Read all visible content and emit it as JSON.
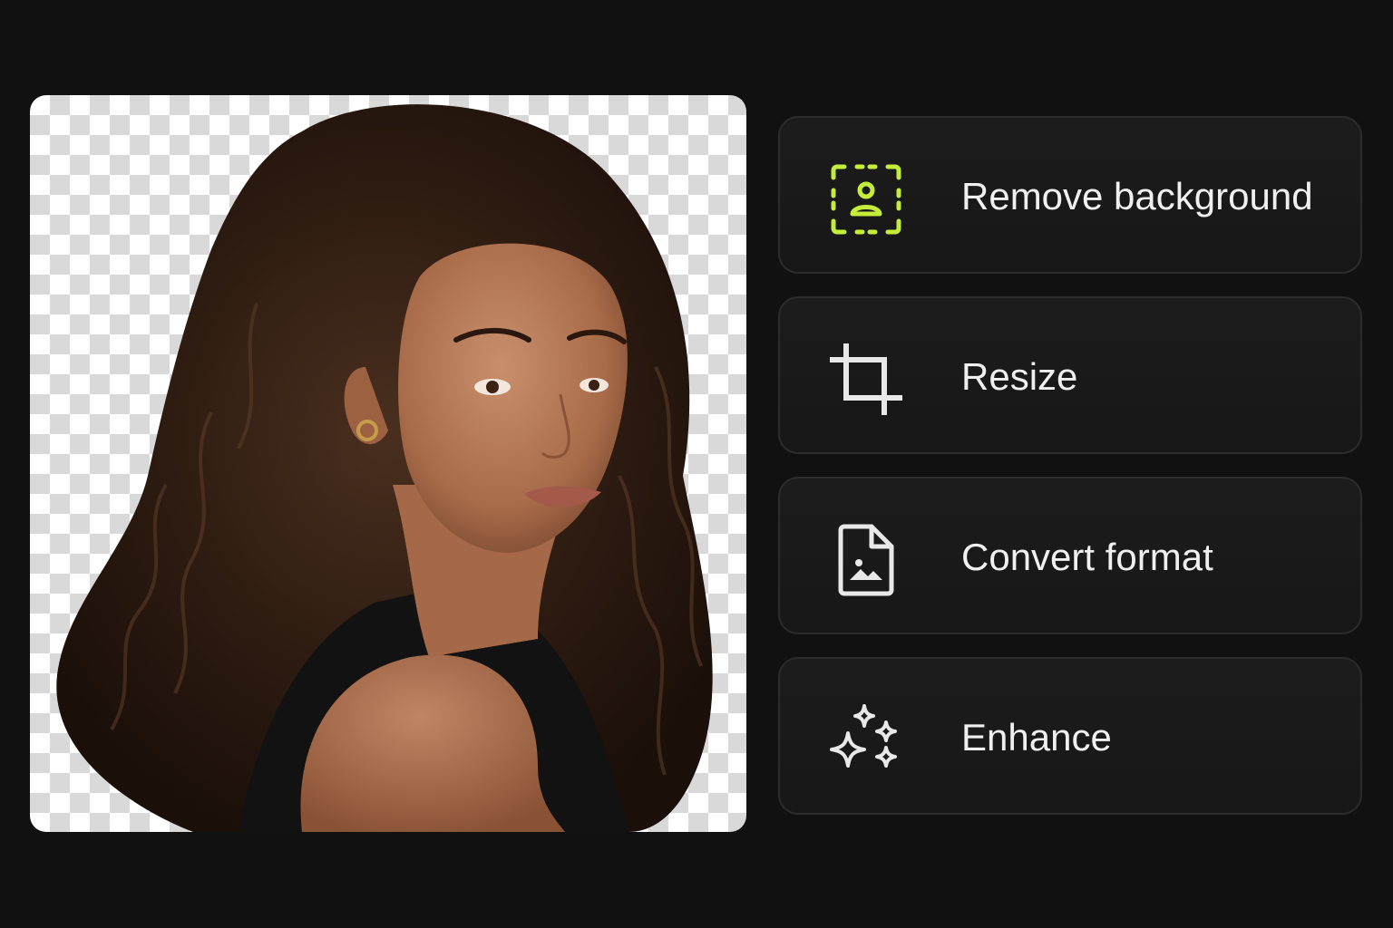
{
  "accent_color": "#c6ec3a",
  "preview": {
    "background": "transparency-checkerboard",
    "subject": "portrait-cutout"
  },
  "actions": [
    {
      "label": "Remove background",
      "icon": "person-select-icon",
      "active": true
    },
    {
      "label": "Resize",
      "icon": "crop-icon",
      "active": false
    },
    {
      "label": "Convert format",
      "icon": "image-file-icon",
      "active": false
    },
    {
      "label": "Enhance",
      "icon": "sparkles-icon",
      "active": false
    }
  ]
}
